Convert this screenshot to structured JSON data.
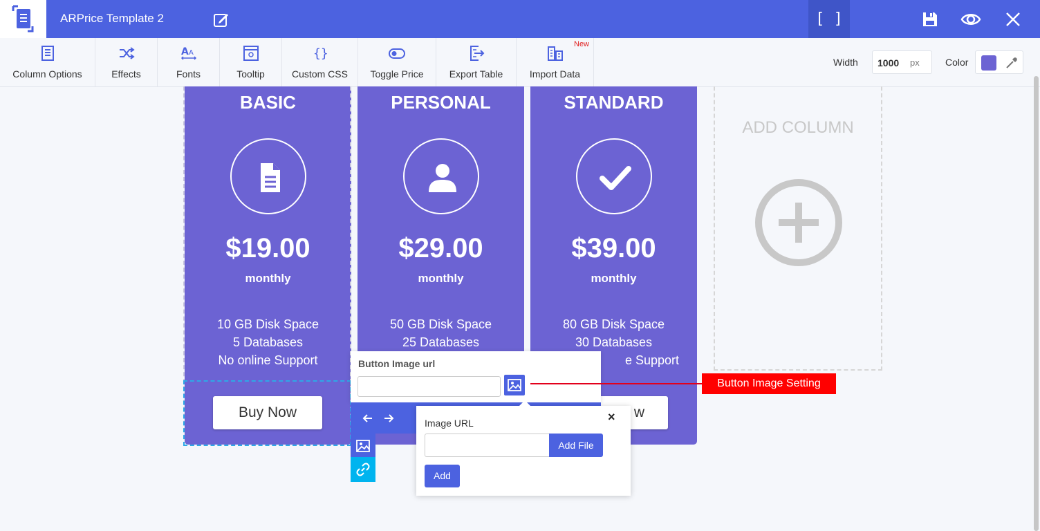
{
  "header": {
    "title": "ARPrice Template 2",
    "fullscreen_label": "[ ]",
    "icons": [
      "logo-icon",
      "edit-icon",
      "save-icon",
      "preview-icon",
      "close-icon"
    ]
  },
  "toolbar": {
    "items": [
      {
        "label": "Column Options",
        "icon": "column-options-icon"
      },
      {
        "label": "Effects",
        "icon": "shuffle-icon"
      },
      {
        "label": "Fonts",
        "icon": "fonts-icon"
      },
      {
        "label": "Tooltip",
        "icon": "tooltip-icon"
      },
      {
        "label": "Custom CSS",
        "icon": "braces-icon"
      },
      {
        "label": "Toggle Price",
        "icon": "toggle-icon"
      },
      {
        "label": "Export Table",
        "icon": "export-icon"
      },
      {
        "label": "Import Data",
        "icon": "import-icon"
      }
    ],
    "new_badge": "New",
    "width_label": "Width",
    "width_value": "1000",
    "width_unit": "px",
    "color_label": "Color",
    "color_value": "#6c63d3"
  },
  "columns": [
    {
      "title": "BASIC",
      "icon": "document-icon",
      "price": "$19.00",
      "period": "monthly",
      "features": [
        "10 GB Disk Space",
        "5 Databases",
        "No online Support"
      ],
      "button": "Buy Now"
    },
    {
      "title": "PERSONAL",
      "icon": "user-icon",
      "price": "$29.00",
      "period": "monthly",
      "features": [
        "50 GB Disk Space",
        "25 Databases"
      ]
    },
    {
      "title": "STANDARD",
      "icon": "check-icon",
      "price": "$39.00",
      "period": "monthly",
      "features": [
        "80 GB Disk Space",
        "30 Databases",
        "e Support"
      ],
      "button_fragment": "w"
    }
  ],
  "add_column": {
    "label": "ADD COLUMN",
    "icon": "plus-circle-icon"
  },
  "button_image_popup": {
    "label": "Button Image url",
    "input_value": "",
    "icon": "image-icon"
  },
  "callout": {
    "text": "Button Image Setting"
  },
  "image_url_popup": {
    "label": "Image URL",
    "input_value": "",
    "add_file": "Add File",
    "add": "Add",
    "close": "×"
  },
  "colors": {
    "header": "#4c62e0",
    "column": "#6c63d3",
    "accent_cyan": "#00b4ef",
    "callout": "#ff0000"
  }
}
